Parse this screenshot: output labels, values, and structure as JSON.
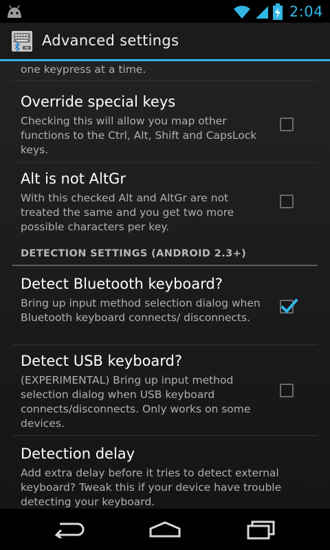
{
  "status_bar": {
    "time": "2:04",
    "accent_color": "#33b5e5",
    "icons": [
      "android-icon",
      "wifi-icon",
      "signal-icon",
      "battery-charging-icon"
    ]
  },
  "action_bar": {
    "title": "Advanced settings",
    "icon": "keyboard-bluetooth-icon"
  },
  "preferences": {
    "partial_summary": "one keypress at a time.",
    "override_special_keys": {
      "title": "Override special keys",
      "summary": "Checking this will allow you map other functions to the Ctrl, Alt, Shift and CapsLock keys.",
      "checked": false
    },
    "alt_not_altgr": {
      "title": "Alt is not AltGr",
      "summary": "With this checked Alt and AltGr are not treated the same and you get two more possible characters per key.",
      "checked": false
    },
    "section_header": "DETECTION SETTINGS (ANDROID 2.3+)",
    "detect_bluetooth": {
      "title": "Detect Bluetooth keyboard?",
      "summary": "Bring up input method selection dialog when Bluetooth keyboard connects/ disconnects.",
      "checked": true
    },
    "detect_usb": {
      "title": "Detect USB keyboard?",
      "summary": "(EXPERIMENTAL) Bring up input method selection dialog when USB keyboard connects/disconnects. Only works on some devices.",
      "checked": false
    },
    "detection_delay": {
      "title": "Detection delay",
      "summary": "Add extra delay before it tries to detect external keyboard? Tweak this if your device have trouble detecting your keyboard."
    }
  },
  "nav_bar": {
    "icons": [
      "back-icon",
      "home-icon",
      "recent-apps-icon"
    ]
  }
}
